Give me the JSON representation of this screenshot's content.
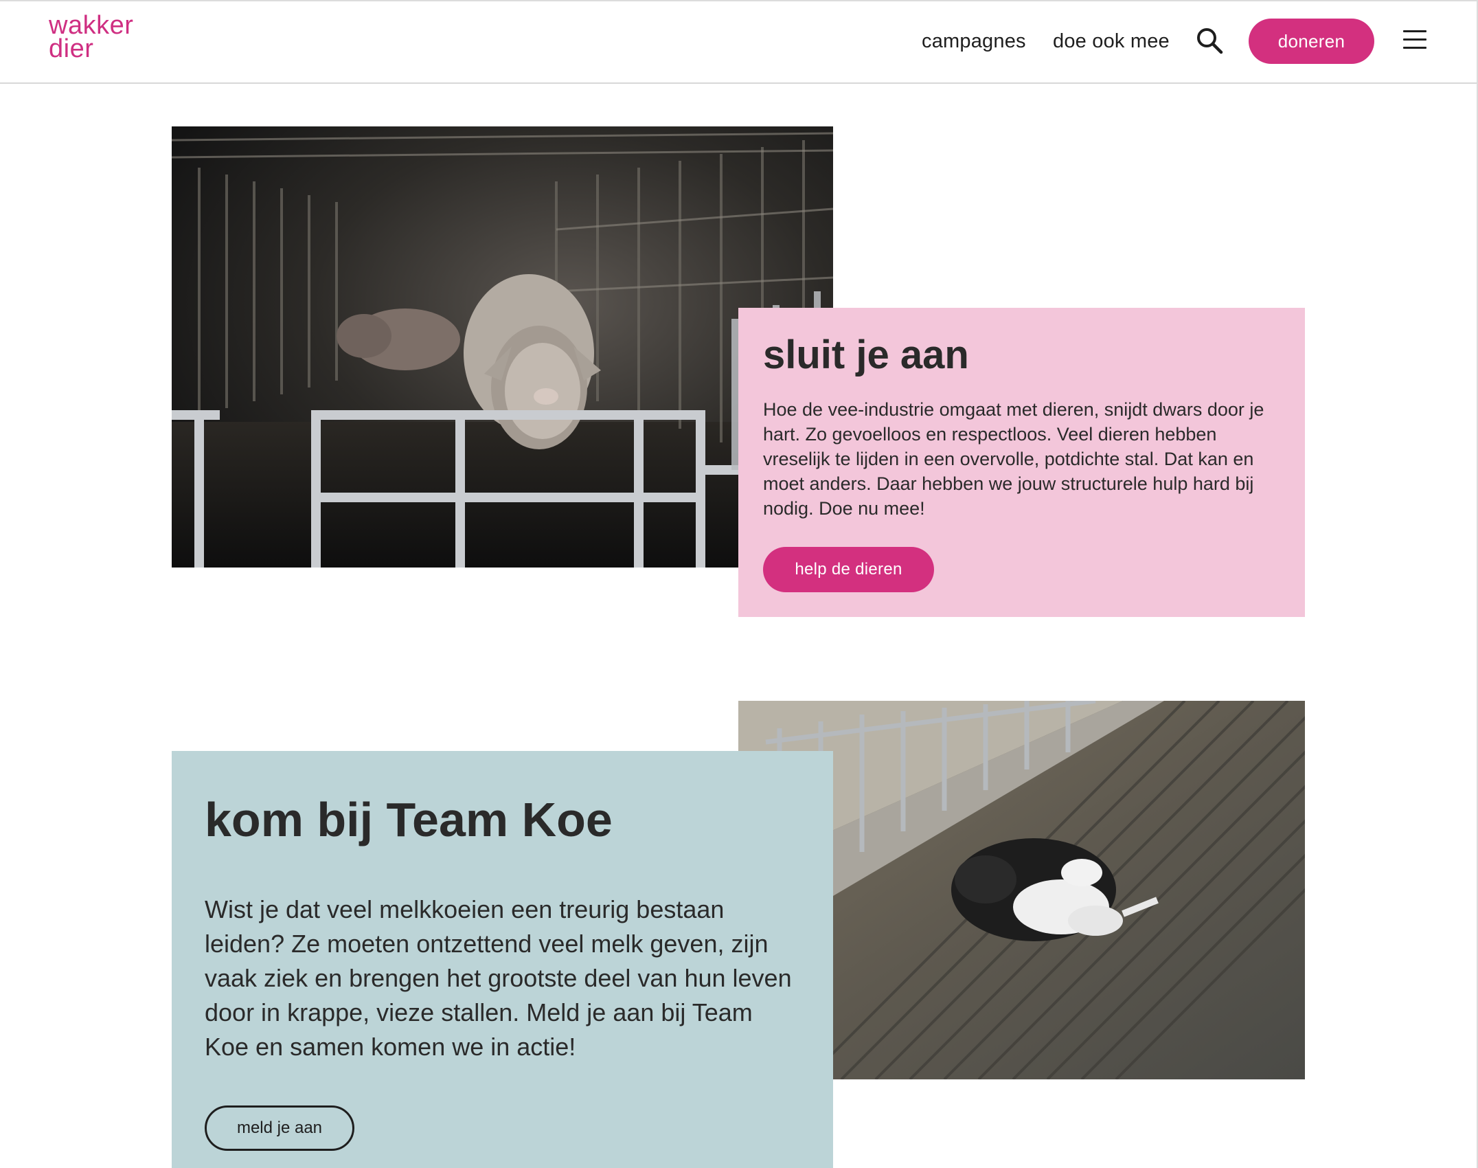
{
  "header": {
    "logo_line1": "wakker",
    "logo_line2": "dier",
    "nav": {
      "campagnes": "campagnes",
      "doe_ook_mee": "doe ook mee"
    },
    "donate_label": "doneren",
    "icons": {
      "search": "search-icon",
      "menu": "hamburger-menu-icon"
    }
  },
  "section_join": {
    "title": "sluit je aan",
    "text": "Hoe de vee-industrie omgaat met dieren, snijdt dwars door je hart. Zo gevoelloos en respectloos. Veel dieren hebben vreselijk te lijden in een overvolle, potdichte stal. Dat kan en moet anders. Daar hebben we jouw structurele hulp hard bij nodig. Doe nu mee!",
    "button_label": "help de dieren"
  },
  "section_team_koe": {
    "title": "kom bij Team Koe",
    "text": "Wist je dat veel melkkoeien een treurig bestaan leiden? Ze moeten ontzettend veel melk geven, zijn vaak ziek en brengen het grootste deel van hun leven door in krappe, vieze stallen. Meld je aan bij Team Koe en samen komen we in actie!",
    "button_label": "meld je aan"
  },
  "colors": {
    "brand_pink": "#d3307f",
    "card_pink": "#f3c6da",
    "card_blue": "#bcd4d7",
    "text_dark": "#2a2a2a"
  }
}
